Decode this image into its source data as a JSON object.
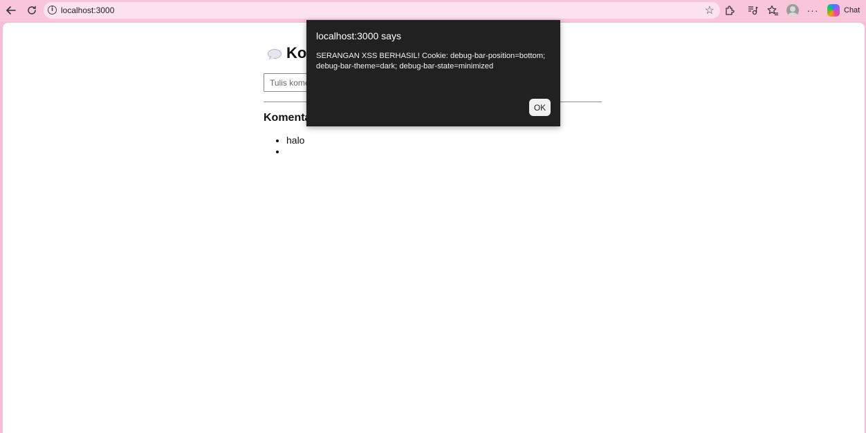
{
  "browser": {
    "url": "localhost:3000",
    "chat_label": "Chat"
  },
  "page": {
    "title": "Ko",
    "input_placeholder": "Tulis komen",
    "section_title": "Komenta",
    "comments": [
      "halo",
      ""
    ]
  },
  "dialog": {
    "title": "localhost:3000 says",
    "message": "SERANGAN XSS BERHASIL! Cookie: debug-bar-position=bottom; debug-bar-theme=dark; debug-bar-state=minimized",
    "ok_label": "OK"
  }
}
